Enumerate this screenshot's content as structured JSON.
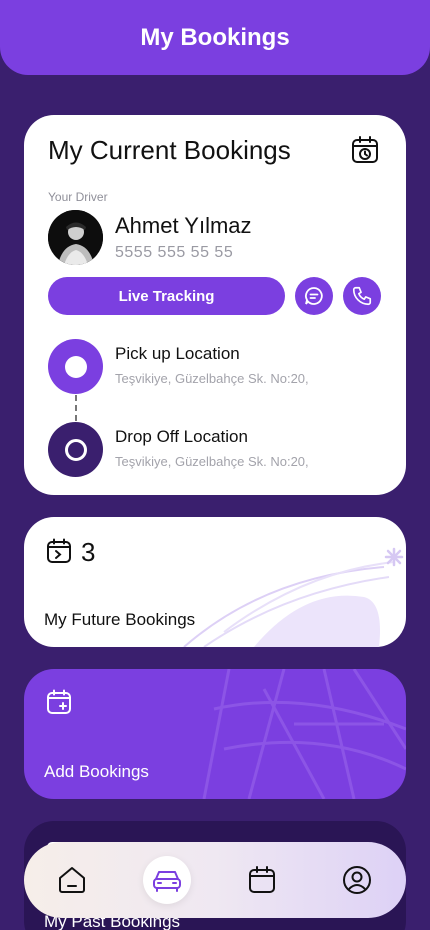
{
  "header": {
    "title": "My Bookings"
  },
  "current": {
    "title": "My Current Bookings",
    "driver_label": "Your Driver",
    "driver_name": "Ahmet Yılmaz",
    "driver_phone": "5555 555 55 55",
    "live_tracking_label": "Live Tracking",
    "pickup": {
      "title": "Pick up Location",
      "address": "Teşvikiye, Güzelbahçe Sk. No:20,"
    },
    "dropoff": {
      "title": "Drop Off Location",
      "address": "Teşvikiye, Güzelbahçe Sk. No:20,"
    }
  },
  "future": {
    "count": "3",
    "label": "My Future Bookings"
  },
  "add": {
    "label": "Add Bookings"
  },
  "past": {
    "label": "My Past Bookings"
  },
  "nav": {
    "items": [
      {
        "icon": "home-icon"
      },
      {
        "icon": "car-icon",
        "active": true
      },
      {
        "icon": "calendar-icon"
      },
      {
        "icon": "profile-icon"
      }
    ]
  },
  "colors": {
    "primary": "#7b3fe0",
    "background": "#3a1f6e",
    "dark_card": "#2a1555",
    "card": "#ffffff"
  }
}
